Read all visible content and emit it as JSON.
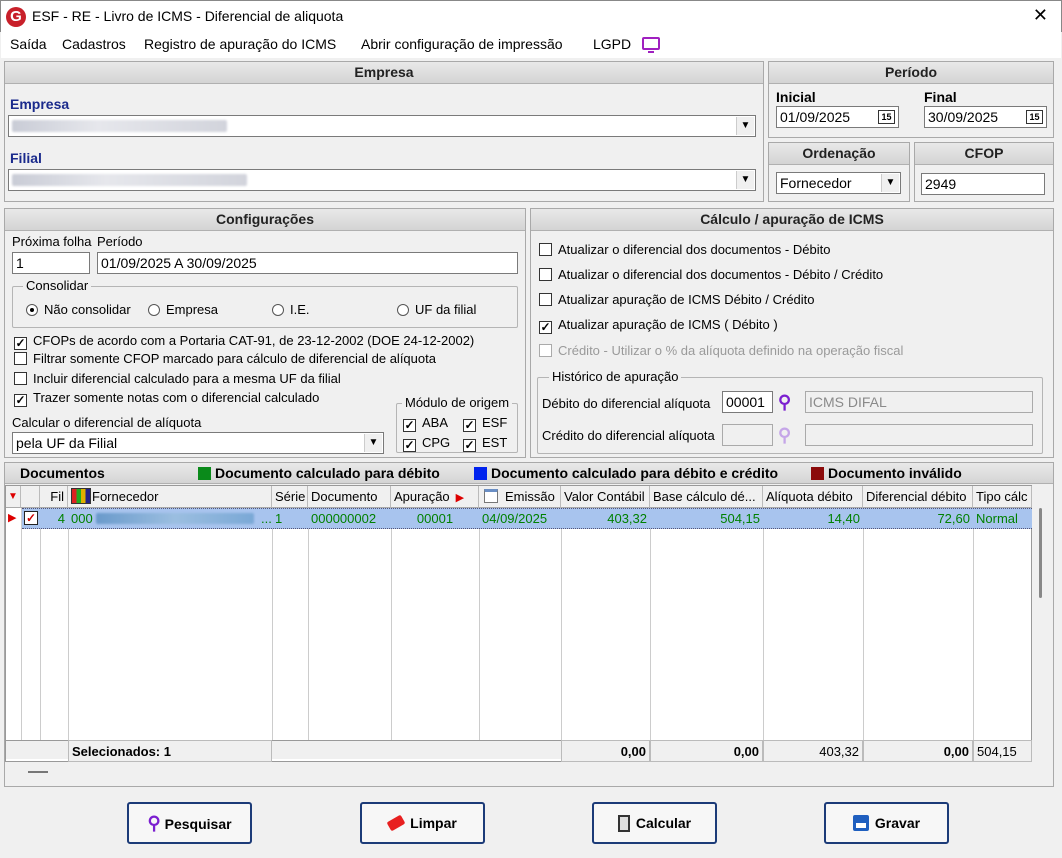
{
  "window": {
    "title": "ESF - RE - Livro de ICMS - Diferencial de aliquota",
    "logo": "G"
  },
  "menu": [
    "Saída",
    "Cadastros",
    "Registro de apuração do ICMS",
    "Abrir configuração de impressão",
    "LGPD"
  ],
  "empresa": {
    "header": "Empresa",
    "empresa_label": "Empresa",
    "filial_label": "Filial"
  },
  "periodo": {
    "header": "Período",
    "inicial_label": "Inicial",
    "inicial_value": "01/09/2025",
    "final_label": "Final",
    "final_value": "30/09/2025",
    "cal_icon": "15"
  },
  "ordenacao": {
    "header": "Ordenação",
    "value": "Fornecedor"
  },
  "cfop": {
    "header": "CFOP",
    "value": "2949"
  },
  "config": {
    "header": "Configurações",
    "proxima_label": "Próxima folha",
    "proxima_value": "1",
    "periodo_label": "Período",
    "periodo_value": "01/09/2025 A 30/09/2025",
    "consolidar_label": "Consolidar",
    "radios": [
      "Não consolidar",
      "Empresa",
      "I.E.",
      "UF da filial"
    ],
    "checks": [
      {
        "label": "CFOPs de acordo com a Portaria CAT-91, de 23-12-2002 (DOE 24-12-2002)",
        "checked": true
      },
      {
        "label": "Filtrar somente CFOP marcado para cálculo de diferencial de alíquota",
        "checked": false
      },
      {
        "label": "Incluir diferencial calculado para a mesma UF da filial",
        "checked": false
      },
      {
        "label": "Trazer somente notas com o diferencial calculado",
        "checked": true
      }
    ],
    "calc_label": "Calcular o diferencial de alíquota",
    "calc_value": "pela UF da Filial",
    "modulo_label": "Módulo de origem",
    "modulos": [
      "ABA",
      "ESF",
      "CPG",
      "EST"
    ]
  },
  "calculo": {
    "header": "Cálculo / apuração de ICMS",
    "checks": [
      {
        "label": "Atualizar o diferencial dos documentos - Débito",
        "checked": false
      },
      {
        "label": "Atualizar o diferencial dos documentos - Débito / Crédito",
        "checked": false
      },
      {
        "label": "Atualizar apuração de ICMS Débito / Crédito",
        "checked": false
      },
      {
        "label": "Atualizar apuração de ICMS ( Débito )",
        "checked": true
      },
      {
        "label": "Crédito - Utilizar o % da alíquota definido na operação fiscal",
        "checked": false
      }
    ],
    "historico_label": "Histórico de apuração",
    "debito_label": "Débito do diferencial alíquota",
    "debito_code": "00001",
    "debito_desc": "ICMS DIFAL",
    "credito_label": "Crédito do diferencial alíquota"
  },
  "documentos": {
    "header": "Documentos",
    "legend": [
      {
        "label": "Documento calculado para débito",
        "color": "#0a8a1a"
      },
      {
        "label": "Documento calculado para débito e crédito",
        "color": "#0022ee"
      },
      {
        "label": "Documento inválido",
        "color": "#8b0a0a"
      }
    ],
    "columns": [
      "Fil",
      "Fornecedor",
      "Série",
      "Documento",
      "Apuração",
      "Emissão",
      "Valor Contábil",
      "Base cálculo dé...",
      "Alíquota débito",
      "Diferencial débito",
      "Tipo cálc"
    ],
    "row": {
      "fil": "4",
      "fornecedor": "000",
      "serie": "1",
      "documento": "000000002",
      "apuracao": "00001",
      "emissao": "04/09/2025",
      "valor_contabil": "403,32",
      "base_calculo": "504,15",
      "aliquota": "14,40",
      "diferencial": "72,60",
      "tipo": "Normal"
    },
    "footer": {
      "selecionados": "Selecionados: 1",
      "valor_contabil": "0,00",
      "base_calculo": "0,00",
      "aliquota": "403,32",
      "diferencial": "0,00",
      "tipo": "504,15"
    }
  },
  "buttons": {
    "pesquisar": "Pesquisar",
    "limpar": "Limpar",
    "calcular": "Calcular",
    "gravar": "Gravar"
  },
  "colors": {
    "row_selected": "#a8c4ee",
    "accent": "#1c3b78",
    "icon_purple": "#7b1fd0"
  }
}
